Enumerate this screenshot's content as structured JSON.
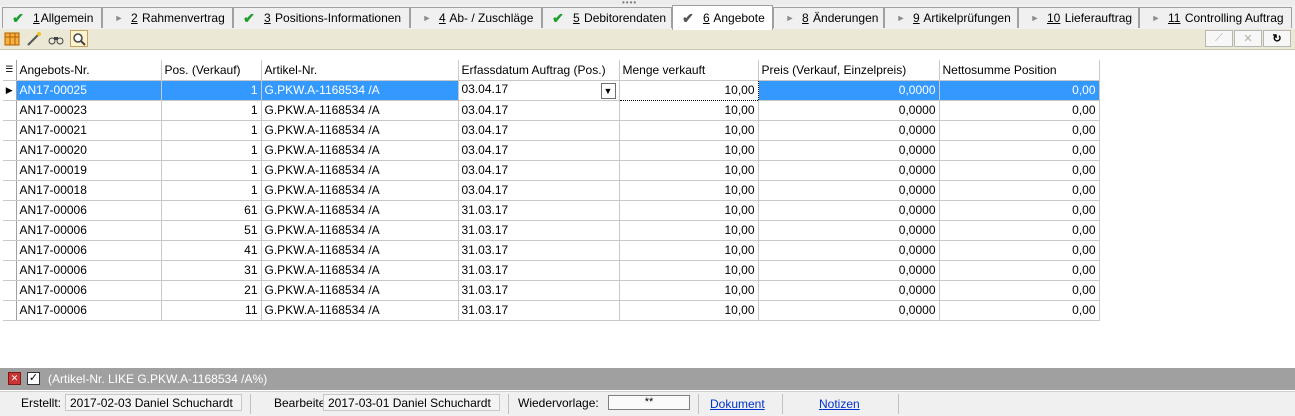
{
  "tabs": [
    {
      "num": "1",
      "label": "Allgemein",
      "icon": "check-icon"
    },
    {
      "num": "2",
      "label": "Rahmenvertrag",
      "icon": "arrow-icon"
    },
    {
      "num": "3",
      "label": "Positions-Informationen",
      "icon": "check-icon"
    },
    {
      "num": "4",
      "label": "Ab- / Zuschläge",
      "icon": "arrow-icon"
    },
    {
      "num": "5",
      "label": "Debitorendaten",
      "icon": "check-icon"
    },
    {
      "num": "6",
      "label": "Angebote",
      "icon": "check-icon"
    },
    {
      "num": "8",
      "label": "Änderungen",
      "icon": "arrow-icon"
    },
    {
      "num": "9",
      "label": "Artikelprüfungen",
      "icon": "arrow-icon"
    },
    {
      "num": "10",
      "label": "Lieferauftrag",
      "icon": "arrow-icon"
    },
    {
      "num": "11",
      "label": "Controlling Auftrag",
      "icon": "arrow-icon"
    }
  ],
  "grid": {
    "columns": [
      "Angebots-Nr.",
      "Pos. (Verkauf)",
      "Artikel-Nr.",
      "Erfassdatum Auftrag (Pos.)",
      "Menge verkauft",
      "Preis (Verkauf, Einzelpreis)",
      "Nettosumme Position"
    ],
    "rows": [
      [
        "AN17-00025",
        "1",
        "G.PKW.A-1168534 /A",
        "03.04.17",
        "10,00",
        "0,0000",
        "0,00"
      ],
      [
        "AN17-00023",
        "1",
        "G.PKW.A-1168534 /A",
        "03.04.17",
        "10,00",
        "0,0000",
        "0,00"
      ],
      [
        "AN17-00021",
        "1",
        "G.PKW.A-1168534 /A",
        "03.04.17",
        "10,00",
        "0,0000",
        "0,00"
      ],
      [
        "AN17-00020",
        "1",
        "G.PKW.A-1168534 /A",
        "03.04.17",
        "10,00",
        "0,0000",
        "0,00"
      ],
      [
        "AN17-00019",
        "1",
        "G.PKW.A-1168534 /A",
        "03.04.17",
        "10,00",
        "0,0000",
        "0,00"
      ],
      [
        "AN17-00018",
        "1",
        "G.PKW.A-1168534 /A",
        "03.04.17",
        "10,00",
        "0,0000",
        "0,00"
      ],
      [
        "AN17-00006",
        "61",
        "G.PKW.A-1168534 /A",
        "31.03.17",
        "10,00",
        "0,0000",
        "0,00"
      ],
      [
        "AN17-00006",
        "51",
        "G.PKW.A-1168534 /A",
        "31.03.17",
        "10,00",
        "0,0000",
        "0,00"
      ],
      [
        "AN17-00006",
        "41",
        "G.PKW.A-1168534 /A",
        "31.03.17",
        "10,00",
        "0,0000",
        "0,00"
      ],
      [
        "AN17-00006",
        "31",
        "G.PKW.A-1168534 /A",
        "31.03.17",
        "10,00",
        "0,0000",
        "0,00"
      ],
      [
        "AN17-00006",
        "21",
        "G.PKW.A-1168534 /A",
        "31.03.17",
        "10,00",
        "0,0000",
        "0,00"
      ],
      [
        "AN17-00006",
        "11",
        "G.PKW.A-1168534 /A",
        "31.03.17",
        "10,00",
        "0,0000",
        "0,00"
      ]
    ]
  },
  "filter": {
    "text": "(Artikel-Nr. LIKE G.PKW.A-1168534 /A%)"
  },
  "status": {
    "created_label": "Erstellt:",
    "created_value": "2017-02-03  Daniel Schuchardt",
    "edited_label": "Bearbeitet:",
    "edited_value": "2017-03-01  Daniel Schuchardt",
    "resubmission_label": "Wiedervorlage:",
    "resubmission_value": "**",
    "document_link": "Dokument",
    "notes_link": "Notizen"
  },
  "colors": {
    "selection": "#3399ff",
    "check": "#1e9e2e",
    "filter_bar": "#a0a0a0",
    "link": "#0033cc"
  }
}
